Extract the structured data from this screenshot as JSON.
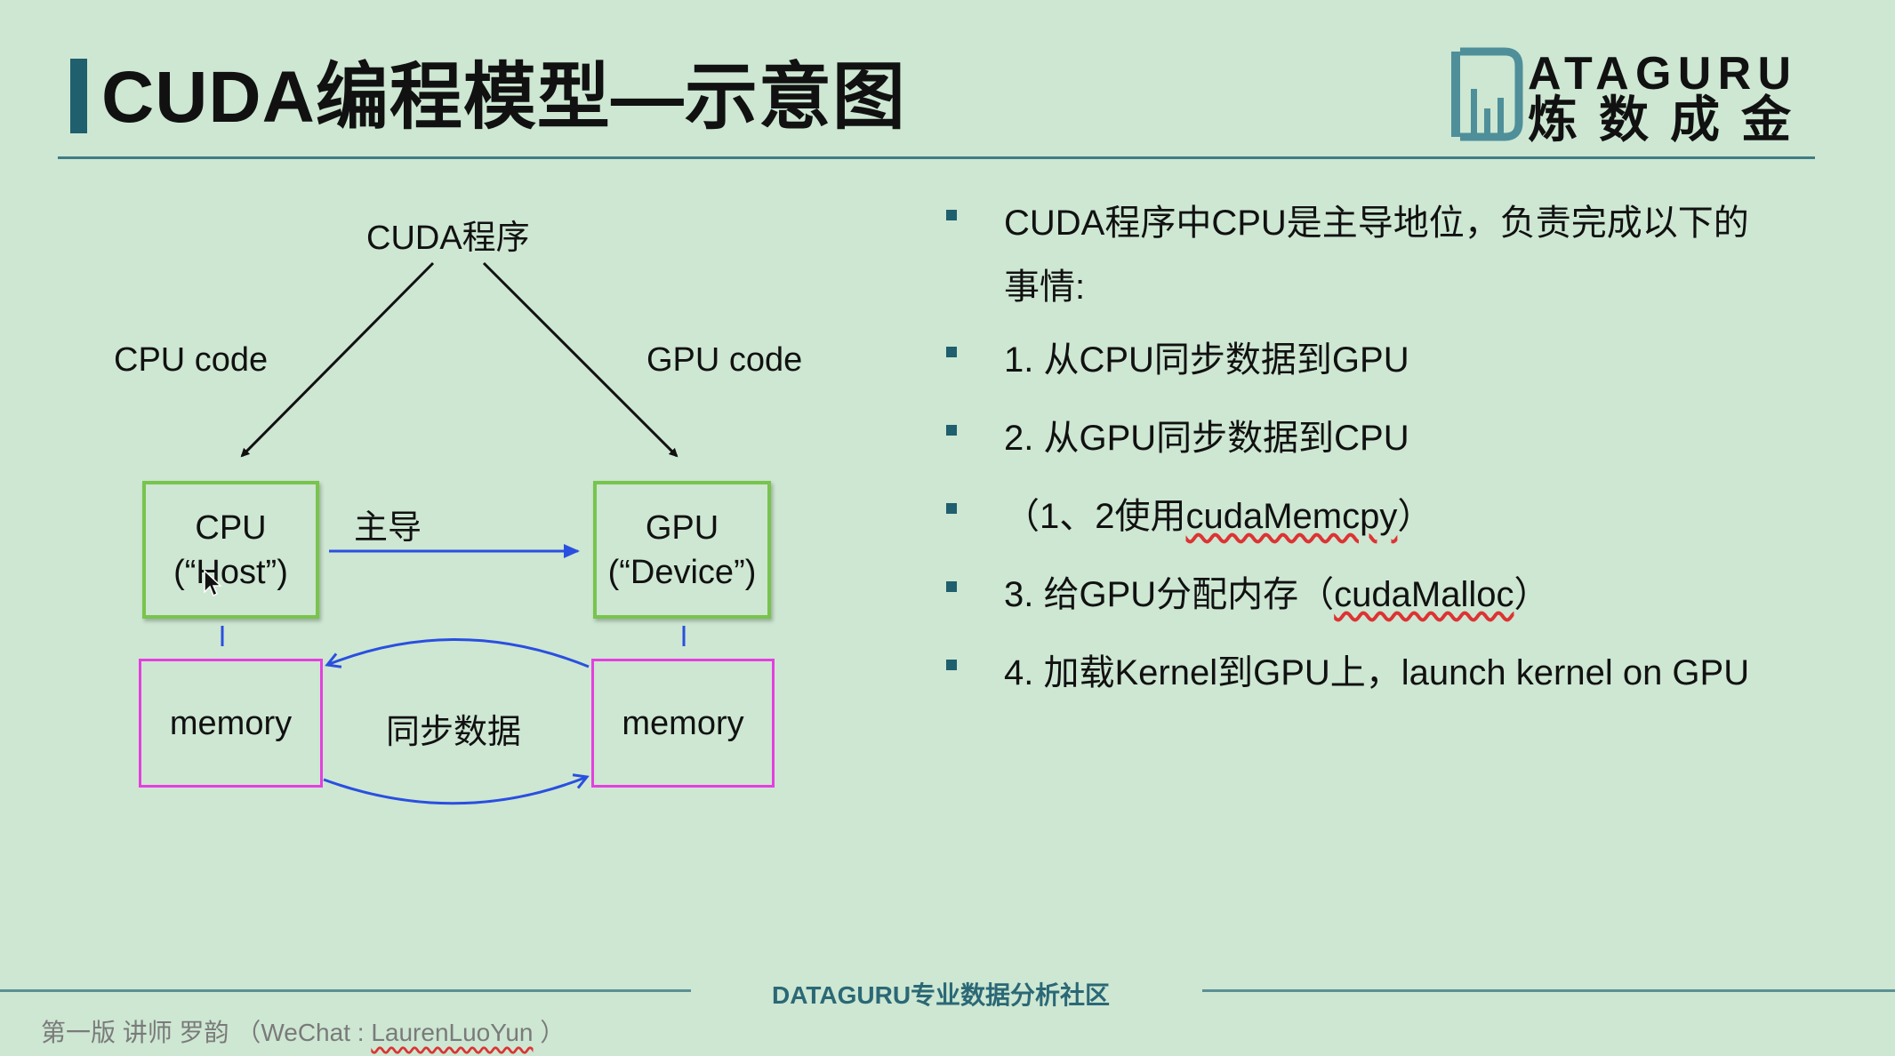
{
  "slide": {
    "title": "CUDA编程模型—示意图",
    "logo": {
      "text_top": "ATAGURU",
      "text_bottom": "炼数成金"
    },
    "colors": {
      "background": "#cde7d2",
      "accent": "#1f5f6e",
      "host_box": "#78c44c",
      "memory_box": "#e43fe0",
      "arrow_blue": "#2a4fe0"
    }
  },
  "diagram": {
    "root": "CUDA程序",
    "left_branch": "CPU code",
    "right_branch": "GPU code",
    "cpu_box": {
      "line1": "CPU",
      "line2": "(“Host”)"
    },
    "gpu_box": {
      "line1": "GPU",
      "line2": "(“Device”)"
    },
    "control_label": "主导",
    "memory_left": "memory",
    "memory_right": "memory",
    "sync_label": "同步数据"
  },
  "bullets": [
    {
      "text": "CUDA程序中CPU是主导地位，负责完成以下的"
    },
    {
      "text": "事情:",
      "continuation": true
    },
    {
      "text": "1. 从CPU同步数据到GPU"
    },
    {
      "text": "2. 从GPU同步数据到CPU"
    },
    {
      "prefix": "（1、2使用",
      "code": "cudaMemcpy",
      "suffix": "）"
    },
    {
      "prefix": "3. 给GPU分配内存（",
      "code": "cudaMalloc",
      "suffix": "）"
    },
    {
      "text": "4. 加载Kernel到GPU上，launch kernel on GPU"
    }
  ],
  "footer": {
    "center": "DATAGURU专业数据分析社区",
    "credit_prefix": "第一版 讲师 罗韵 （WeChat : ",
    "credit_id": "LaurenLuoYun",
    "credit_suffix": " ）"
  }
}
